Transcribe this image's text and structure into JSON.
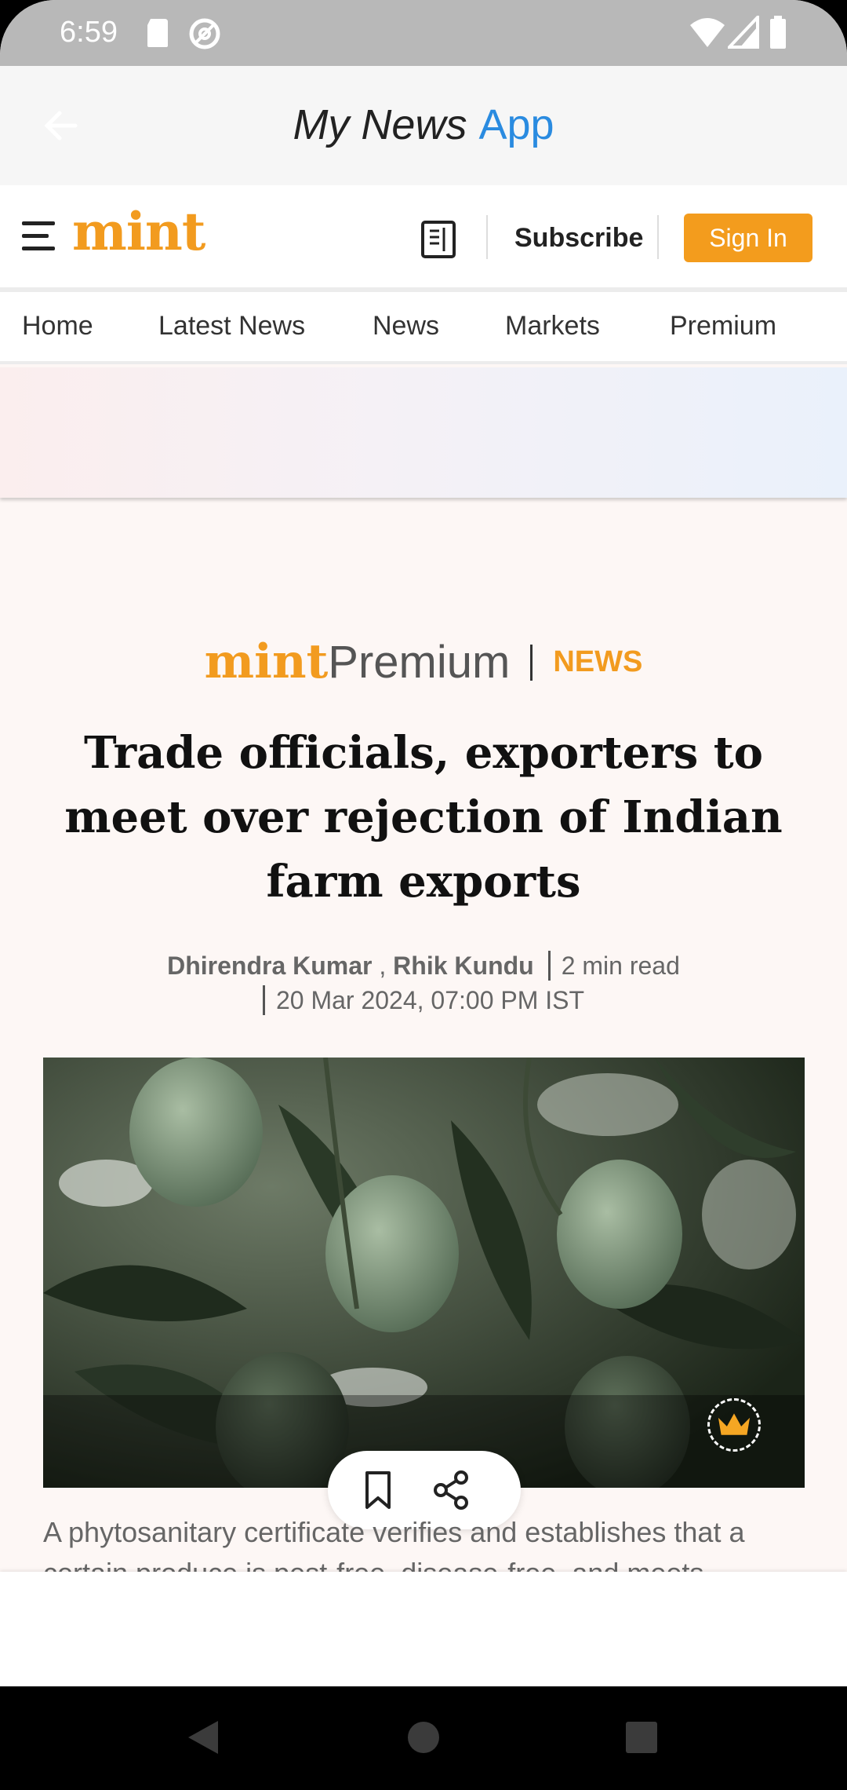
{
  "status_bar": {
    "time": "6:59",
    "icons": [
      "sd-card-icon",
      "at-sign-icon",
      "wifi-icon",
      "signal-icon",
      "battery-icon"
    ]
  },
  "app_bar": {
    "title_main": "My News",
    "title_accent": "App",
    "accent_color": "#2a8be0"
  },
  "header": {
    "logo": "mint",
    "subscribe_label": "Subscribe",
    "signin_label": "Sign In",
    "brand_color": "#f29b1f"
  },
  "nav": {
    "tabs": [
      "Home",
      "Latest News",
      "News",
      "Markets",
      "Premium"
    ]
  },
  "article": {
    "brand_logo": "mint",
    "brand_section_premium": "Premium",
    "category": "NEWS",
    "headline": "Trade officials, exporters to meet over rejection of Indian farm exports",
    "author_1": "Dhirendra Kumar",
    "author_2": "Rhik Kundu",
    "read_time": "2 min read",
    "date": "20 Mar 2024, 07:00 PM IST",
    "summary": "A phytosanitary certificate verifies and establishes that a certain produce is pest-free, disease-free, and meets"
  },
  "actions": {
    "icons": [
      "bookmark-icon",
      "share-icon"
    ]
  },
  "system_nav": {
    "icons": [
      "back-icon",
      "home-icon",
      "recents-icon"
    ]
  }
}
